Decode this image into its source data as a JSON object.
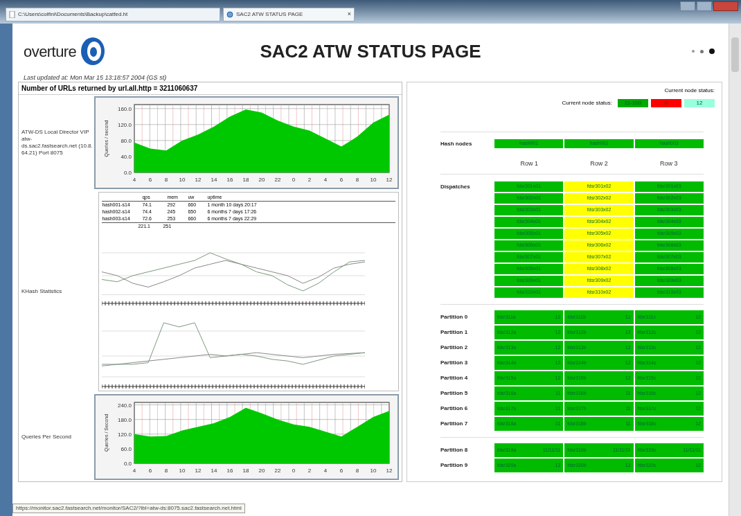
{
  "browser": {
    "address": "C:\\Users\\colfini\\Documents\\Backup\\catfed.ht",
    "tab_title": "SAC2 ATW STATUS PAGE",
    "tab_close": "×"
  },
  "header": {
    "logo_text": "overture",
    "title": "SAC2 ATW STATUS PAGE",
    "last_updated": "Last updated at: Mon Mar 15 13:18:57 2004 (GS st)"
  },
  "left_panel": {
    "heading": "Number of URLs returned by url.all.http = 3211060637",
    "sections": [
      {
        "kind": "area",
        "label": "ATW-DS Local Director VIP atw-",
        "label_small": "ds.sac2.fastsearch.net (10.8.64.21) Port 8075",
        "chart_data": {
          "type": "area",
          "ylabel": "Queries / second",
          "categories": [
            "4",
            "6",
            "8",
            "10",
            "12",
            "14",
            "16",
            "18",
            "20",
            "22",
            "0",
            "2",
            "4",
            "6",
            "8",
            "10",
            "12"
          ],
          "grid": true,
          "ylim": [
            0,
            170
          ],
          "yticks": [
            {
              "value": 0,
              "label": "0.0"
            },
            {
              "value": 40,
              "label": "40.0"
            },
            {
              "value": 80,
              "label": "80.0"
            },
            {
              "value": 120,
              "label": "120.0"
            },
            {
              "value": 160,
              "label": "160.0"
            }
          ],
          "series": [
            {
              "color": "#00c800",
              "values": [
                75,
                60,
                55,
                80,
                95,
                115,
                140,
                158,
                150,
                130,
                115,
                105,
                85,
                65,
                90,
                125,
                145
              ]
            }
          ]
        }
      },
      {
        "kind": "stats",
        "label": "KHash Statistics",
        "table": {
          "columns": [
            "",
            "qps",
            "mem",
            "uw",
            "uptime"
          ],
          "rows": [
            [
              "hash001-s14",
              "74.1",
              "292",
              "660",
              "1 month 10 days 20:17"
            ],
            [
              "hash002-s14",
              "74.4",
              "245",
              "650",
              "6 months 7 days 17:26"
            ],
            [
              "hash003-s14",
              "72.6",
              "253",
              "660",
              "6 months 7 days 22:29"
            ]
          ],
          "totals": [
            "221.1",
            "251"
          ]
        }
      },
      {
        "kind": "area",
        "label": "Queries Per Second",
        "chart_data": {
          "type": "area",
          "ylabel": "Queries / Second",
          "categories": [
            "4",
            "6",
            "8",
            "10",
            "12",
            "14",
            "16",
            "18",
            "20",
            "22",
            "0",
            "2",
            "4",
            "6",
            "8",
            "10",
            "12"
          ],
          "grid": true,
          "ylim": [
            0,
            250
          ],
          "yticks": [
            {
              "value": 0,
              "label": "0.0"
            },
            {
              "value": 60,
              "label": "60.0"
            },
            {
              "value": 120,
              "label": "120.0"
            },
            {
              "value": 180,
              "label": "180.0"
            },
            {
              "value": 240,
              "label": "240.0"
            }
          ],
          "series": [
            {
              "color": "#00c800",
              "values": [
                120,
                110,
                112,
                135,
                150,
                165,
                190,
                228,
                205,
                180,
                160,
                150,
                130,
                110,
                150,
                190,
                215
              ]
            }
          ]
        }
      }
    ]
  },
  "right_panel": {
    "status_title": "Current node status:",
    "legend_label": "Current node status:",
    "legend": [
      {
        "text": "11-100",
        "color": "#00aa00"
      },
      {
        "text": "0",
        "color": "#ff0000"
      },
      {
        "text": "12",
        "color": "#99ffdd"
      }
    ],
    "hash_label": "Hash nodes",
    "hash_nodes": [
      {
        "text": "hash001",
        "color": "#00bb00"
      },
      {
        "text": "hash002",
        "color": "#00bb00"
      },
      {
        "text": "hash003",
        "color": "#00bb00"
      }
    ],
    "columns": [
      "Row 1",
      "Row 2",
      "Row 3"
    ],
    "dispatch_label": "Dispatches",
    "dispatches": [
      [
        {
          "text": "fdsr301x01",
          "color": "#00bb00"
        },
        {
          "text": "fdsr301x02",
          "color": "#ffff00"
        },
        {
          "text": "fdsr301x03",
          "color": "#00bb00"
        }
      ],
      [
        {
          "text": "fdsr302x01",
          "color": "#00bb00"
        },
        {
          "text": "fdsr302x02",
          "color": "#ffff00"
        },
        {
          "text": "fdsr302x03",
          "color": "#00bb00"
        }
      ],
      [
        {
          "text": "fdsr303x01",
          "color": "#00bb00"
        },
        {
          "text": "fdsr303x02",
          "color": "#ffff00"
        },
        {
          "text": "fdsr303x03",
          "color": "#00bb00"
        }
      ],
      [
        {
          "text": "fdsr304x01",
          "color": "#00bb00"
        },
        {
          "text": "fdsr304x02",
          "color": "#ffff00"
        },
        {
          "text": "fdsr304x03",
          "color": "#00bb00"
        }
      ],
      [
        {
          "text": "fdsr305x01",
          "color": "#00bb00"
        },
        {
          "text": "fdsr305x02",
          "color": "#ffff00"
        },
        {
          "text": "fdsr305x03",
          "color": "#00bb00"
        }
      ],
      [
        {
          "text": "fdsr306x01",
          "color": "#00bb00"
        },
        {
          "text": "fdsr306x02",
          "color": "#ffff00"
        },
        {
          "text": "fdsr306x03",
          "color": "#00bb00"
        }
      ],
      [
        {
          "text": "fdsr307x01",
          "color": "#00bb00"
        },
        {
          "text": "fdsr307x02",
          "color": "#ffff00"
        },
        {
          "text": "fdsr307x03",
          "color": "#00bb00"
        }
      ],
      [
        {
          "text": "fdsr308x01",
          "color": "#00bb00"
        },
        {
          "text": "fdsr308x02",
          "color": "#ffff00"
        },
        {
          "text": "fdsr308x03",
          "color": "#00bb00"
        }
      ],
      [
        {
          "text": "fdsr309x01",
          "color": "#00bb00"
        },
        {
          "text": "fdsr309x02",
          "color": "#ffff00"
        },
        {
          "text": "fdsr309x03",
          "color": "#00bb00"
        }
      ],
      [
        {
          "text": "fdsr310x01",
          "color": "#00bb00"
        },
        {
          "text": "fdsr310x02",
          "color": "#ffff00"
        },
        {
          "text": "fdsr310x03",
          "color": "#00bb00"
        }
      ]
    ],
    "partition_groups": [
      [
        {
          "label": "Partition 0",
          "cells": [
            {
              "name": "fdsr311a",
              "count": "12",
              "color": "#00bb00"
            },
            {
              "name": "fdsr311b",
              "count": "12",
              "color": "#00bb00"
            },
            {
              "name": "fdsr311c",
              "count": "12",
              "color": "#00bb00"
            }
          ]
        },
        {
          "label": "Partition 1",
          "cells": [
            {
              "name": "fdsr312a",
              "count": "12",
              "color": "#00bb00"
            },
            {
              "name": "fdsr312b",
              "count": "12",
              "color": "#00bb00"
            },
            {
              "name": "fdsr312c",
              "count": "12",
              "color": "#00bb00"
            }
          ]
        },
        {
          "label": "Partition 2",
          "cells": [
            {
              "name": "fdsr313a",
              "count": "12",
              "color": "#00bb00"
            },
            {
              "name": "fdsr313b",
              "count": "12",
              "color": "#00bb00"
            },
            {
              "name": "fdsr313c",
              "count": "12",
              "color": "#00bb00"
            }
          ]
        },
        {
          "label": "Partition 3",
          "cells": [
            {
              "name": "fdsr314a",
              "count": "12",
              "color": "#00bb00"
            },
            {
              "name": "fdsr314b",
              "count": "12",
              "color": "#00bb00"
            },
            {
              "name": "fdsr314c",
              "count": "12",
              "color": "#00bb00"
            }
          ]
        },
        {
          "label": "Partition 4",
          "cells": [
            {
              "name": "fdsr315a",
              "count": "12",
              "color": "#00bb00"
            },
            {
              "name": "fdsr315b",
              "count": "12",
              "color": "#00bb00"
            },
            {
              "name": "fdsr315c",
              "count": "12",
              "color": "#00bb00"
            }
          ]
        },
        {
          "label": "Partition 5",
          "cells": [
            {
              "name": "fdsr316a",
              "count": "11",
              "color": "#00bb00"
            },
            {
              "name": "fdsr316b",
              "count": "11",
              "color": "#00bb00"
            },
            {
              "name": "fdsr316c",
              "count": "12",
              "color": "#00bb00"
            }
          ]
        },
        {
          "label": "Partition 6",
          "cells": [
            {
              "name": "fdsr317a",
              "count": "11",
              "color": "#00bb00"
            },
            {
              "name": "fdsr317b",
              "count": "11",
              "color": "#00bb00"
            },
            {
              "name": "fdsr317c",
              "count": "12",
              "color": "#00bb00"
            }
          ]
        },
        {
          "label": "Partition 7",
          "cells": [
            {
              "name": "fdsr318a",
              "count": "11",
              "color": "#00bb00"
            },
            {
              "name": "fdsr318b",
              "count": "11",
              "color": "#00bb00"
            },
            {
              "name": "fdsr318c",
              "count": "12",
              "color": "#00bb00"
            }
          ]
        }
      ],
      [
        {
          "label": "Partition 8",
          "cells": [
            {
              "name": "fdsr319a",
              "count": "11/11/11",
              "color": "#00bb00"
            },
            {
              "name": "fdsr319b",
              "count": "11/11/11",
              "color": "#00bb00"
            },
            {
              "name": "fdsr319c",
              "count": "11/11/11",
              "color": "#00bb00"
            }
          ]
        },
        {
          "label": "Partition 9",
          "cells": [
            {
              "name": "fdsr320a",
              "count": "12",
              "color": "#00bb00"
            },
            {
              "name": "fdsr320b",
              "count": "12",
              "color": "#00bb00"
            },
            {
              "name": "fdsr320c",
              "count": "12",
              "color": "#00bb00"
            }
          ]
        }
      ]
    ]
  },
  "status_link": "https://monitor.sac2.fastsearch.net/monitor/SAC2/?lbl=atw-ds:8075.sac2.fastsearch.net.html"
}
